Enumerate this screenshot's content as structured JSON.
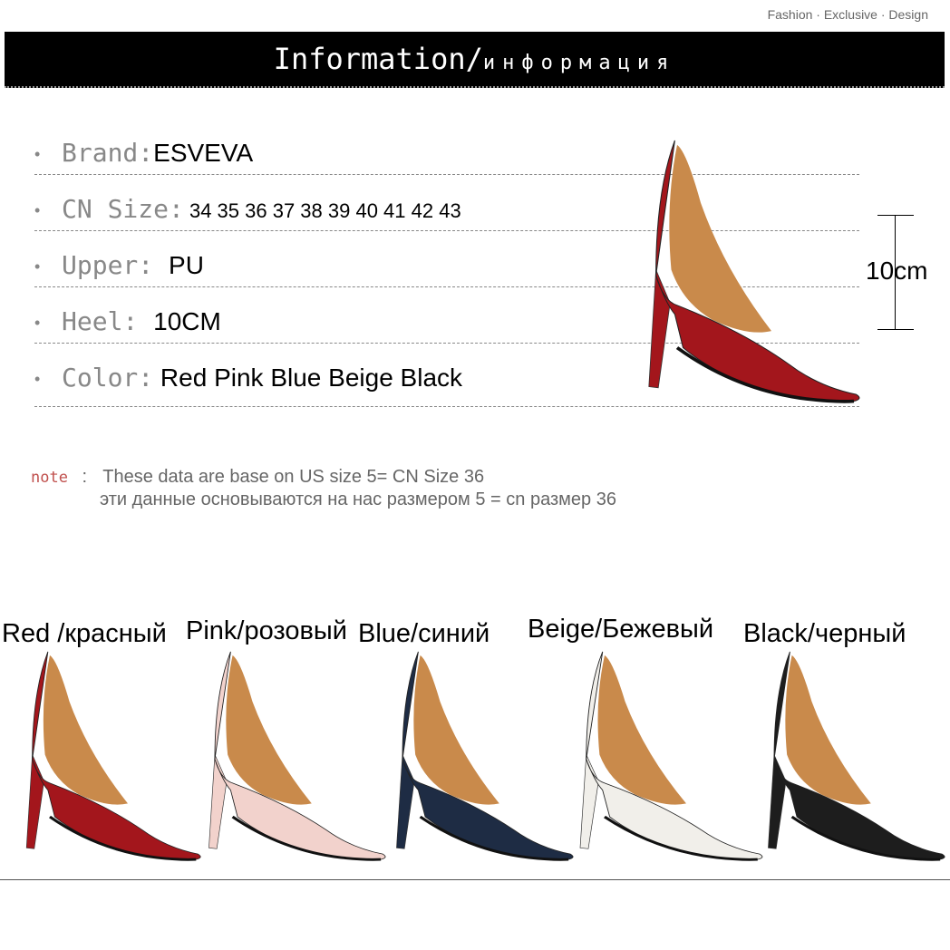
{
  "tagline": "Fashion · Exclusive · Design",
  "header": {
    "title_en": "Information/",
    "title_ru": "информация"
  },
  "specs": [
    {
      "label": "Brand:",
      "value": "ESVEVA"
    },
    {
      "label": "CN Size:",
      "value": " 34 35 36 37 38 39 40 41 42 43"
    },
    {
      "label": "Upper: ",
      "value": " PU"
    },
    {
      "label": "Heel: ",
      "value": " 10CM"
    },
    {
      "label": "Color:",
      "value": " Red Pink Blue Beige Black"
    }
  ],
  "heel_height_label": "10cm",
  "note": {
    "tag": "note",
    "sep": ":",
    "line1": "These data are base on US size 5= CN Size 36",
    "line2": "эти данные основываются на нас размером 5 = cn размер 36"
  },
  "colors": [
    {
      "label": "Red /красный",
      "hex": "#a3161c"
    },
    {
      "label": "Pink/розовый",
      "hex": "#f2d2cc"
    },
    {
      "label": "Blue/синий",
      "hex": "#1e2c44"
    },
    {
      "label": "Beige/Бежевый",
      "hex": "#f1efea"
    },
    {
      "label": "Black/черный",
      "hex": "#1d1d1d"
    }
  ]
}
